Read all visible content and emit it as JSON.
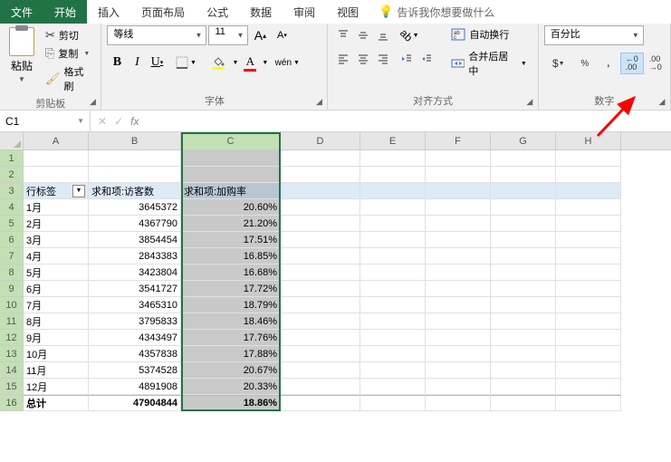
{
  "menu": {
    "file": "文件",
    "home": "开始",
    "insert": "插入",
    "layout": "页面布局",
    "formulas": "公式",
    "data": "数据",
    "review": "审阅",
    "view": "视图",
    "tellme": "告诉我你想要做什么"
  },
  "ribbon": {
    "clipboard": {
      "label": "剪贴板",
      "paste": "粘贴",
      "cut": "剪切",
      "copy": "复制",
      "format_painter": "格式刷"
    },
    "font": {
      "label": "字体",
      "name": "等线",
      "size": "11",
      "wen": "wén"
    },
    "alignment": {
      "label": "对齐方式",
      "wrap": "自动换行",
      "merge": "合并后居中"
    },
    "number": {
      "label": "数字",
      "format": "百分比"
    }
  },
  "namebox": "C1",
  "columns": [
    "A",
    "B",
    "C",
    "D",
    "E",
    "F",
    "G",
    "H"
  ],
  "rows": [
    "1",
    "2",
    "3",
    "4",
    "5",
    "6",
    "7",
    "8",
    "9",
    "10",
    "11",
    "12",
    "13",
    "14",
    "15",
    "16"
  ],
  "headers": {
    "rowlabel": "行标签",
    "visitors": "求和项:访客数",
    "addrate": "求和项:加购率"
  },
  "data_rows": [
    {
      "m": "1月",
      "v": "3645372",
      "r": "20.60%"
    },
    {
      "m": "2月",
      "v": "4367790",
      "r": "21.20%"
    },
    {
      "m": "3月",
      "v": "3854454",
      "r": "17.51%"
    },
    {
      "m": "4月",
      "v": "2843383",
      "r": "16.85%"
    },
    {
      "m": "5月",
      "v": "3423804",
      "r": "16.68%"
    },
    {
      "m": "6月",
      "v": "3541727",
      "r": "17.72%"
    },
    {
      "m": "7月",
      "v": "3465310",
      "r": "18.79%"
    },
    {
      "m": "8月",
      "v": "3795833",
      "r": "18.46%"
    },
    {
      "m": "9月",
      "v": "4343497",
      "r": "17.76%"
    },
    {
      "m": "10月",
      "v": "4357838",
      "r": "17.88%"
    },
    {
      "m": "11月",
      "v": "5374528",
      "r": "20.67%"
    },
    {
      "m": "12月",
      "v": "4891908",
      "r": "20.33%"
    }
  ],
  "total": {
    "m": "总计",
    "v": "47904844",
    "r": "18.86%"
  },
  "chart_data": {
    "type": "table",
    "title": "",
    "columns": [
      "行标签",
      "求和项:访客数",
      "求和项:加购率"
    ],
    "rows": [
      [
        "1月",
        3645372,
        0.206
      ],
      [
        "2月",
        4367790,
        0.212
      ],
      [
        "3月",
        3854454,
        0.1751
      ],
      [
        "4月",
        2843383,
        0.1685
      ],
      [
        "5月",
        3423804,
        0.1668
      ],
      [
        "6月",
        3541727,
        0.1772
      ],
      [
        "7月",
        3465310,
        0.1879
      ],
      [
        "8月",
        3795833,
        0.1846
      ],
      [
        "9月",
        4343497,
        0.1776
      ],
      [
        "10月",
        4357838,
        0.1788
      ],
      [
        "11月",
        5374528,
        0.2067
      ],
      [
        "12月",
        4891908,
        0.2033
      ],
      [
        "总计",
        47904844,
        0.1886
      ]
    ]
  }
}
